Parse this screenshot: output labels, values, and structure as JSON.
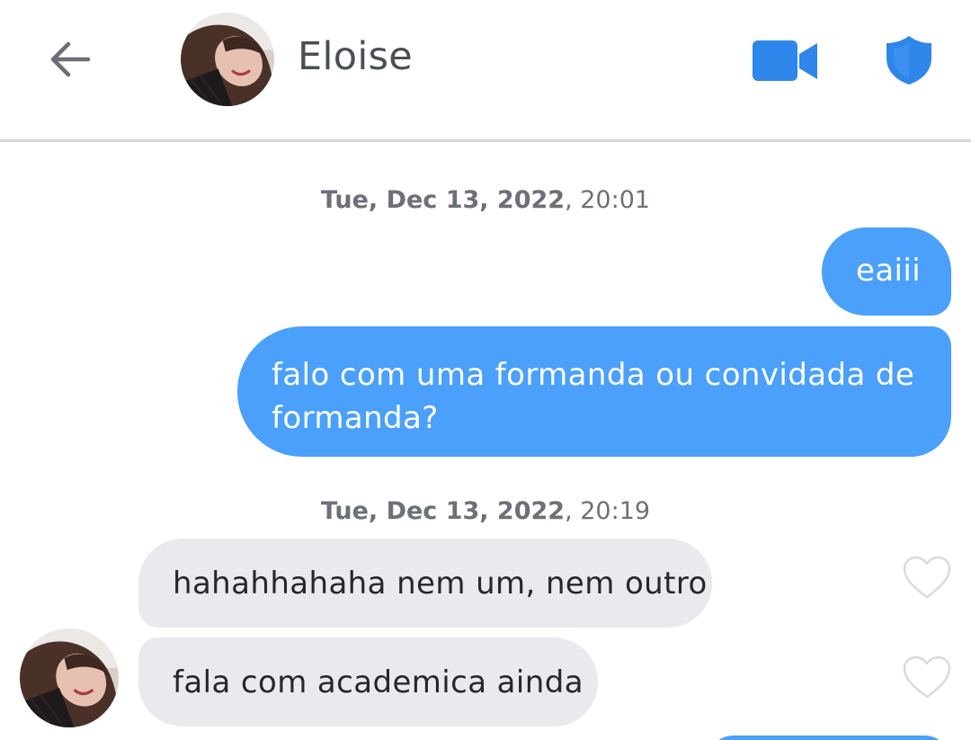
{
  "header": {
    "contact_name": "Eloise",
    "accent_color": "#2f86eb"
  },
  "messages": [
    {
      "timestamp_date": "Tue, Dec 13, 2022",
      "timestamp_sep": ", ",
      "timestamp_time": "20:01",
      "items": [
        {
          "direction": "sent",
          "text": "eaiii"
        },
        {
          "direction": "sent",
          "text": "falo com uma formanda ou convidada de formanda?"
        }
      ]
    },
    {
      "timestamp_date": "Tue, Dec 13, 2022",
      "timestamp_sep": ", ",
      "timestamp_time": "20:19",
      "items": [
        {
          "direction": "received",
          "text": "hahahhahaha nem um, nem outro",
          "liked": false
        },
        {
          "direction": "received",
          "text": "fala com academica ainda",
          "liked": false
        }
      ]
    }
  ],
  "colors": {
    "sent_bubble": "#4aa0fa",
    "received_bubble": "#e9eaee",
    "header_divider": "#d4d6dc"
  },
  "icons": {
    "back": "arrow-left-icon",
    "video": "video-camera-icon",
    "shield": "shield-icon",
    "like": "heart-outline-icon"
  }
}
